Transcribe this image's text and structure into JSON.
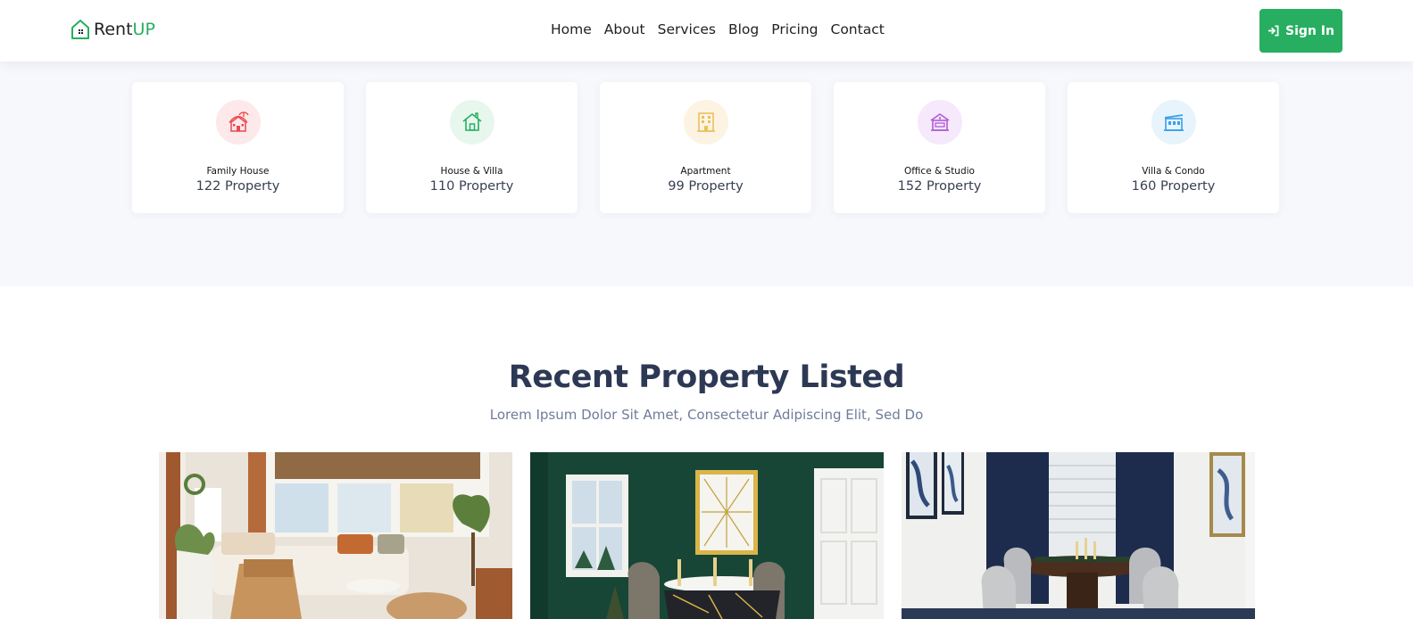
{
  "brand": {
    "name_part1": "Rent",
    "name_part2": "UP",
    "accent_color": "#27ae60"
  },
  "nav": {
    "items": [
      {
        "label": "Home"
      },
      {
        "label": "About"
      },
      {
        "label": "Services"
      },
      {
        "label": "Blog"
      },
      {
        "label": "Pricing"
      },
      {
        "label": "Contact"
      }
    ],
    "signin_label": "Sign In",
    "signin_icon": "sign-in-icon"
  },
  "categories": [
    {
      "title": "Family House",
      "count": "122 Property",
      "icon": "beach-house-icon",
      "bg": "#fde8ea",
      "color": "#e9494f"
    },
    {
      "title": "House & Villa",
      "count": "110 Property",
      "icon": "house-icon",
      "bg": "#e8f7ee",
      "color": "#27ae60"
    },
    {
      "title": "Apartment",
      "count": "99 Property",
      "icon": "apartment-building-icon",
      "bg": "#fdf3e3",
      "color": "#e8c25a"
    },
    {
      "title": "Office & Studio",
      "count": "152 Property",
      "icon": "office-building-icon",
      "bg": "#f5e9fb",
      "color": "#b05bd6"
    },
    {
      "title": "Villa & Condo",
      "count": "160 Property",
      "icon": "condo-building-icon",
      "bg": "#e8f4fc",
      "color": "#3aa0e8"
    }
  ],
  "recent": {
    "title": "Recent Property Listed",
    "subtitle": "Lorem Ipsum Dolor Sit Amet, Consectetur Adipiscing Elit, Sed Do"
  },
  "listings": [
    {
      "image": "living-room-photo"
    },
    {
      "image": "green-dining-room-photo"
    },
    {
      "image": "navy-dining-room-photo"
    }
  ]
}
